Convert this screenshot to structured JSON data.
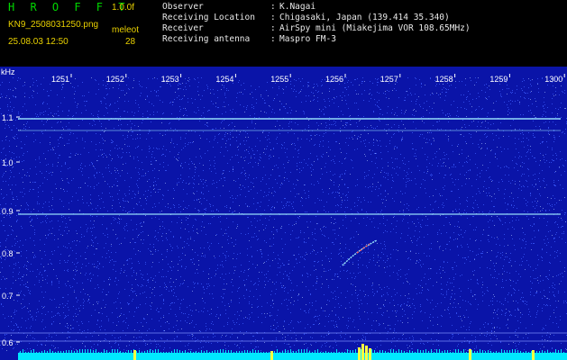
{
  "header": {
    "app_title": "H R O F F T",
    "version": "1.0.0f",
    "filename": "KN9_2508031250.png",
    "meteor_label": "meleot",
    "datetime": "25.08.03 12:50",
    "meteor_count": "28",
    "info_rows": [
      {
        "key": "Observer",
        "sep": ":",
        "value": "K.Nagai"
      },
      {
        "key": "Receiving Location",
        "sep": ":",
        "value": "Chigasaki, Japan (139.414 35.340)"
      },
      {
        "key": "Receiver",
        "sep": ":",
        "value": "AirSpy mini (Miakejima VOR 108.65MHz)"
      },
      {
        "key": "Receiving antenna",
        "sep": ":",
        "value": "Maspro FM-3"
      }
    ]
  },
  "spectrogram": {
    "unit_label": "kHz",
    "x_ticks": [
      "1251",
      "1252",
      "1253",
      "1254",
      "1255",
      "1256",
      "1257",
      "1258",
      "1259",
      "1300"
    ],
    "y_ticks": [
      "1.1",
      "1.0",
      "0.9",
      "0.8",
      "0.7",
      "0.6"
    ],
    "colors": {
      "background": "#0a14a8",
      "noise": "#3c5cff",
      "carrier": "#9ce8ff",
      "meteor": "#ff6060",
      "baseline": "#00e8ff",
      "spike": "#ffff40"
    }
  }
}
